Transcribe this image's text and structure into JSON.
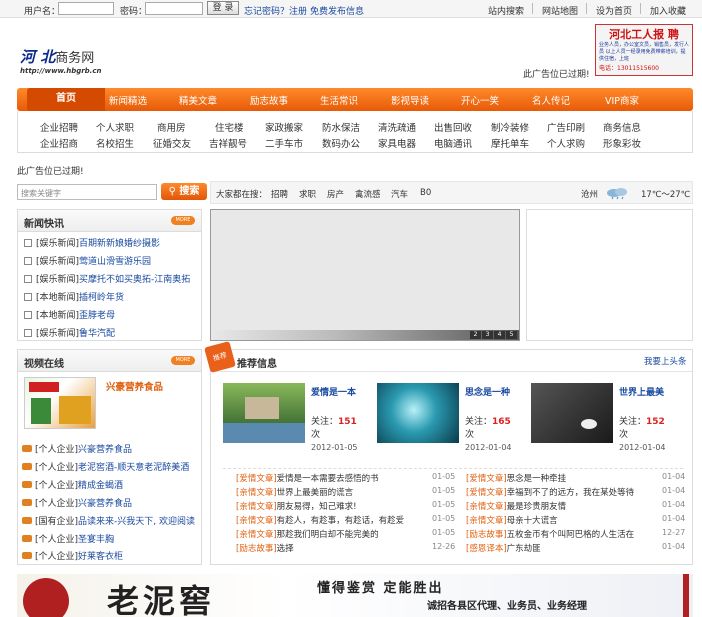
{
  "topbar": {
    "username_label": "用户名：",
    "password_label": "密码：",
    "login_button": "登 录",
    "forgot_password": "忘记密码？",
    "register": "注册",
    "free_post": "免费发布信息",
    "site_search": "站内搜索",
    "site_map": "网站地图",
    "set_home": "设为首页",
    "add_favorite": "加入收藏"
  },
  "header": {
    "logo_main": "河 北",
    "logo_sub": "商务网",
    "logo_url": "http://www.hbgrb.cn",
    "ad_expired": "此广告位已过期!",
    "recruit_title": "河北工人报  聘",
    "recruit_text": "业务人员，办公室文员，销售员，发行人员 以上人员一经录用免费带薪培训，提供住宿，上班",
    "recruit_phone": "电话：13011515600"
  },
  "nav": {
    "items": [
      "首页",
      "新闻精选",
      "精美文章",
      "励志故事",
      "生活常识",
      "影视导读",
      "开心一笑",
      "名人传记",
      "VIP商家"
    ]
  },
  "categories": {
    "row1": [
      "企业招聘",
      "个人求职",
      "商用房",
      "住宅楼",
      "家政搬家",
      "防水保洁",
      "清洗疏通",
      "出售回收",
      "制冷装修",
      "广告印刷",
      "商务信息"
    ],
    "row2": [
      "企业招商",
      "名校招生",
      "征婚交友",
      "吉祥靓号",
      "二手车市",
      "数码办公",
      "家具电器",
      "电脑通讯",
      "摩托单车",
      "个人求购",
      "形象彩妆"
    ]
  },
  "ad_line": "此广告位已过期!",
  "search": {
    "placeholder": "搜索关键字",
    "button": "搜索"
  },
  "hotbar": {
    "label": "大家都在搜：",
    "keywords": [
      "招聘",
      "求职",
      "房产",
      "禽流感",
      "汽车",
      "B0"
    ],
    "city": "沧州",
    "temperature": "17℃～27℃"
  },
  "news_flash": {
    "title": "新闻快讯",
    "more": "MORE",
    "items": [
      {
        "tag": "[娱乐新闻]",
        "text": "百期新新娘婚纱摄影"
      },
      {
        "tag": "[娱乐新闻]",
        "text": "莺道山滑雪游乐园"
      },
      {
        "tag": "[娱乐新闻]",
        "text": "买摩托不如买奥拓-江南奥拓"
      },
      {
        "tag": "[本地新闻]",
        "text": "插柯岭年货"
      },
      {
        "tag": "[本地新闻]",
        "text": "歪脖老母"
      },
      {
        "tag": "[娱乐新闻]",
        "text": "鲁华汽配"
      }
    ]
  },
  "video_online": {
    "title": "视频在线",
    "more": "MORE",
    "feature_title": "兴豪营养食品",
    "items": [
      {
        "tag": "[个人企业]",
        "text": "兴豪营养食品"
      },
      {
        "tag": "[个人企业]",
        "text": "老泥窖酒-顺天意老泥醉美酒"
      },
      {
        "tag": "[个人企业]",
        "text": "精成金蝎酒"
      },
      {
        "tag": "[个人企业]",
        "text": "兴豪营养食品"
      },
      {
        "tag": "[国有企业]",
        "text": "品读来来-兴我天下, 欢迎阅读"
      },
      {
        "tag": "[个人企业]",
        "text": "圣宴丰胸"
      },
      {
        "tag": "[个人企业]",
        "text": "好莱客衣柜"
      }
    ]
  },
  "slider": {
    "pages": [
      "2",
      "3",
      "4",
      "5"
    ]
  },
  "recommend": {
    "title": "推荐信息",
    "ribbon": "推荐",
    "top_link": "我要上头条",
    "cards": [
      {
        "title": "爱情是一本",
        "follow_label": "关注：",
        "follow": "151",
        "unit": "次",
        "date": "2012-01-05",
        "color": "#4a7a3a"
      },
      {
        "title": "思念是一种",
        "follow_label": "关注：",
        "follow": "165",
        "unit": "次",
        "date": "2012-01-04",
        "color": "#1a6a8a"
      },
      {
        "title": "世界上最美",
        "follow_label": "关注：",
        "follow": "152",
        "unit": "次",
        "date": "2012-01-04",
        "color": "#2a2a2a"
      }
    ],
    "left_list": [
      {
        "tag": "[爱情文章]",
        "text": "爱情是一本需要去感悟的书",
        "date": "01-05"
      },
      {
        "tag": "[亲情文章]",
        "text": "世界上最美丽的谎言",
        "date": "01-05"
      },
      {
        "tag": "[亲情文章]",
        "text": "朋友易得，知己难求!",
        "date": "01-05"
      },
      {
        "tag": "[亲情文章]",
        "text": "有趁人，有趁事，有趁话，有趁爱",
        "date": "01-05"
      },
      {
        "tag": "[亲情文章]",
        "text": "那趁我们明白却不能完美的",
        "date": "01-05"
      },
      {
        "tag": "[励志故事]",
        "text": "选择",
        "date": "12-26"
      }
    ],
    "right_list": [
      {
        "tag": "[爱情文章]",
        "text": "思念是一种牵挂",
        "date": "01-04"
      },
      {
        "tag": "[爱情文章]",
        "text": "幸福到不了的远方，我在某处等待",
        "date": "01-04"
      },
      {
        "tag": "[亲情文章]",
        "text": "最是珍贵朋友情",
        "date": "01-04"
      },
      {
        "tag": "[亲情文章]",
        "text": "母亲十大谎言",
        "date": "01-04"
      },
      {
        "tag": "[励志故事]",
        "text": "五枚金币有个叫阿巴格的人生活在",
        "date": "12-27"
      },
      {
        "tag": "[感恩译本]",
        "text": "广东劫匪",
        "date": "01-04"
      }
    ]
  },
  "banner": {
    "brand": "老泥窖",
    "slogan1": "懂得鉴赏  定能胜出",
    "slogan2": "诚招各县区代理、业务员、业务经理"
  }
}
